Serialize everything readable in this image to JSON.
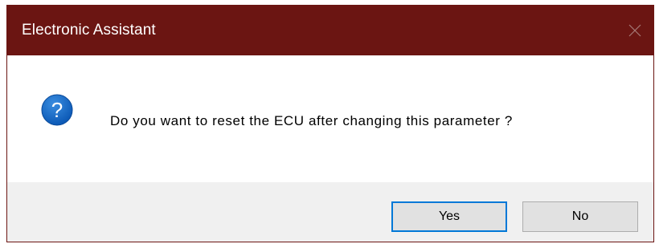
{
  "window": {
    "title": "Electronic Assistant",
    "close_icon": "close-icon",
    "titlebar_color": "#6b1512"
  },
  "dialog": {
    "icon": "question-icon",
    "icon_color": "#1565c0",
    "message": "Do you want to reset the ECU after changing this parameter ?"
  },
  "buttons": {
    "yes_label": "Yes",
    "no_label": "No",
    "default_button": "Yes",
    "focus_color": "#0078d7"
  }
}
